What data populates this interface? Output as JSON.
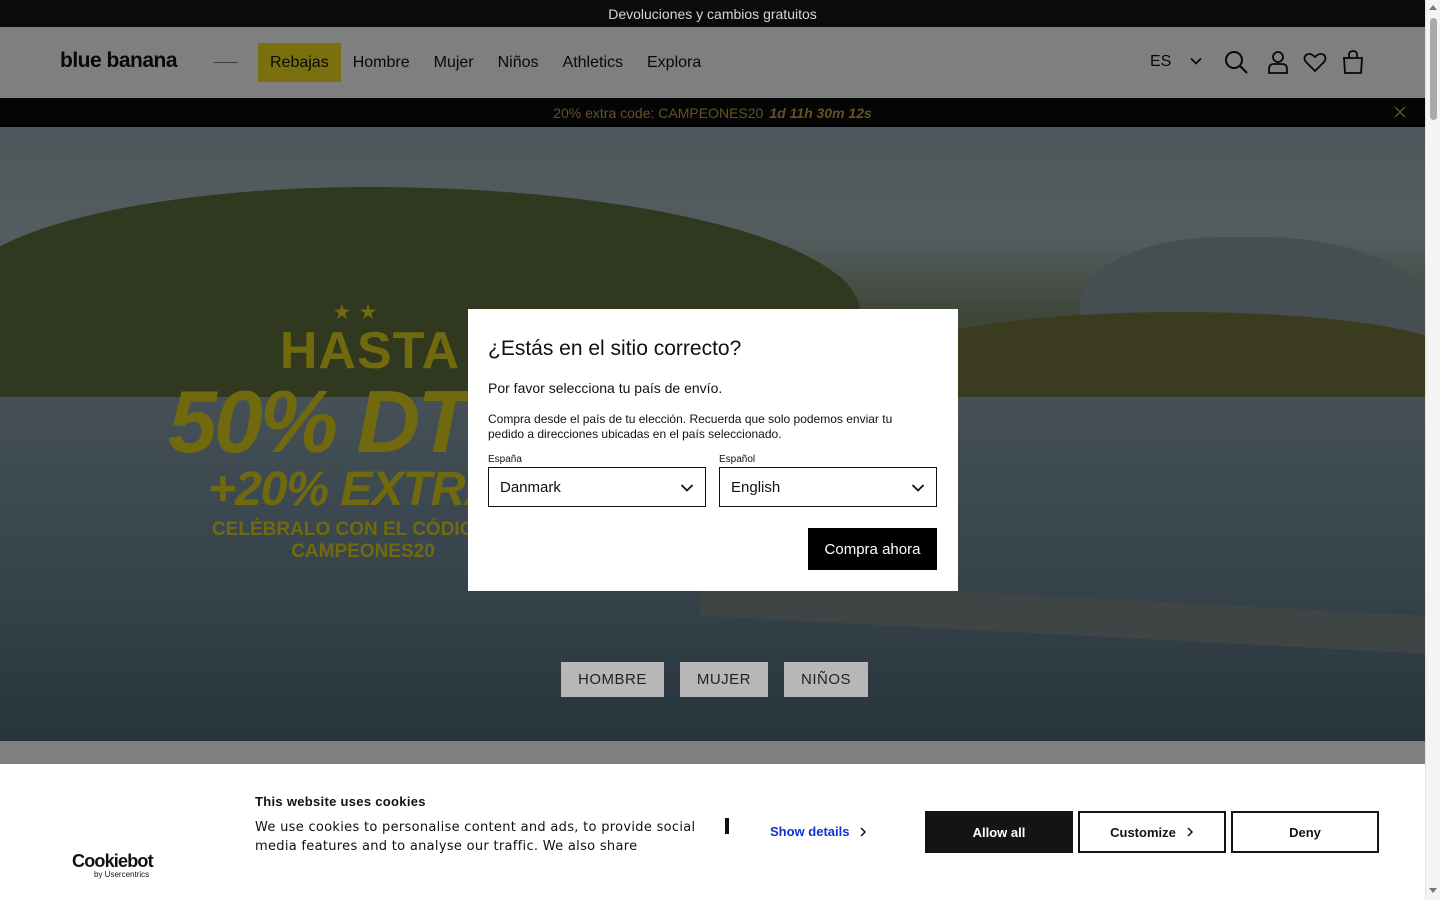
{
  "topbar": {
    "text": "Devoluciones y cambios gratuitos"
  },
  "header": {
    "logo": "blue banana",
    "nav": [
      {
        "label": "Rebajas",
        "active": true
      },
      {
        "label": "Hombre"
      },
      {
        "label": "Mujer"
      },
      {
        "label": "Niños"
      },
      {
        "label": "Athletics"
      },
      {
        "label": "Explora"
      }
    ],
    "language": "ES",
    "icons": [
      "chevron-down-icon",
      "search-icon",
      "account-icon",
      "heart-icon",
      "bag-icon"
    ]
  },
  "promo": {
    "text": "20% extra code: CAMPEONES20",
    "timer": "1d 11h 30m 12s",
    "accent_color": "#c8a448"
  },
  "hero": {
    "stars": "★★",
    "line1": "HASTA",
    "line2": "50% DTO",
    "line3": "+20% EXTRA",
    "line4": "CELÉBRALO CON EL CÓDIGO",
    "line5": "CAMPEONES20",
    "text_color": "#e2d21b",
    "categories": [
      "HOMBRE",
      "MUJER",
      "NIÑOS"
    ]
  },
  "modal": {
    "title": "¿Estás en el sitio correcto?",
    "subtitle": "Por favor selecciona tu país de envío.",
    "description": "Compra desde el país de tu elección. Recuerda que solo podemos enviar tu pedido a direcciones ubicadas en el país seleccionado.",
    "country_label": "España",
    "country_value": "Danmark",
    "language_label": "Español",
    "language_value": "English",
    "button": "Compra ahora"
  },
  "cookie": {
    "logo_main": "Cookiebot",
    "logo_sub": "by Usercentrics",
    "title": "This website uses cookies",
    "text": "We use cookies to personalise content and ads, to provide social media features and to analyse our traffic. We also share information about your use of our site with our social media, advertising and analytics partners.",
    "show_details": "Show details",
    "link_color": "#1032cf",
    "allow_all": "Allow all",
    "customize": "Customize",
    "deny": "Deny"
  }
}
